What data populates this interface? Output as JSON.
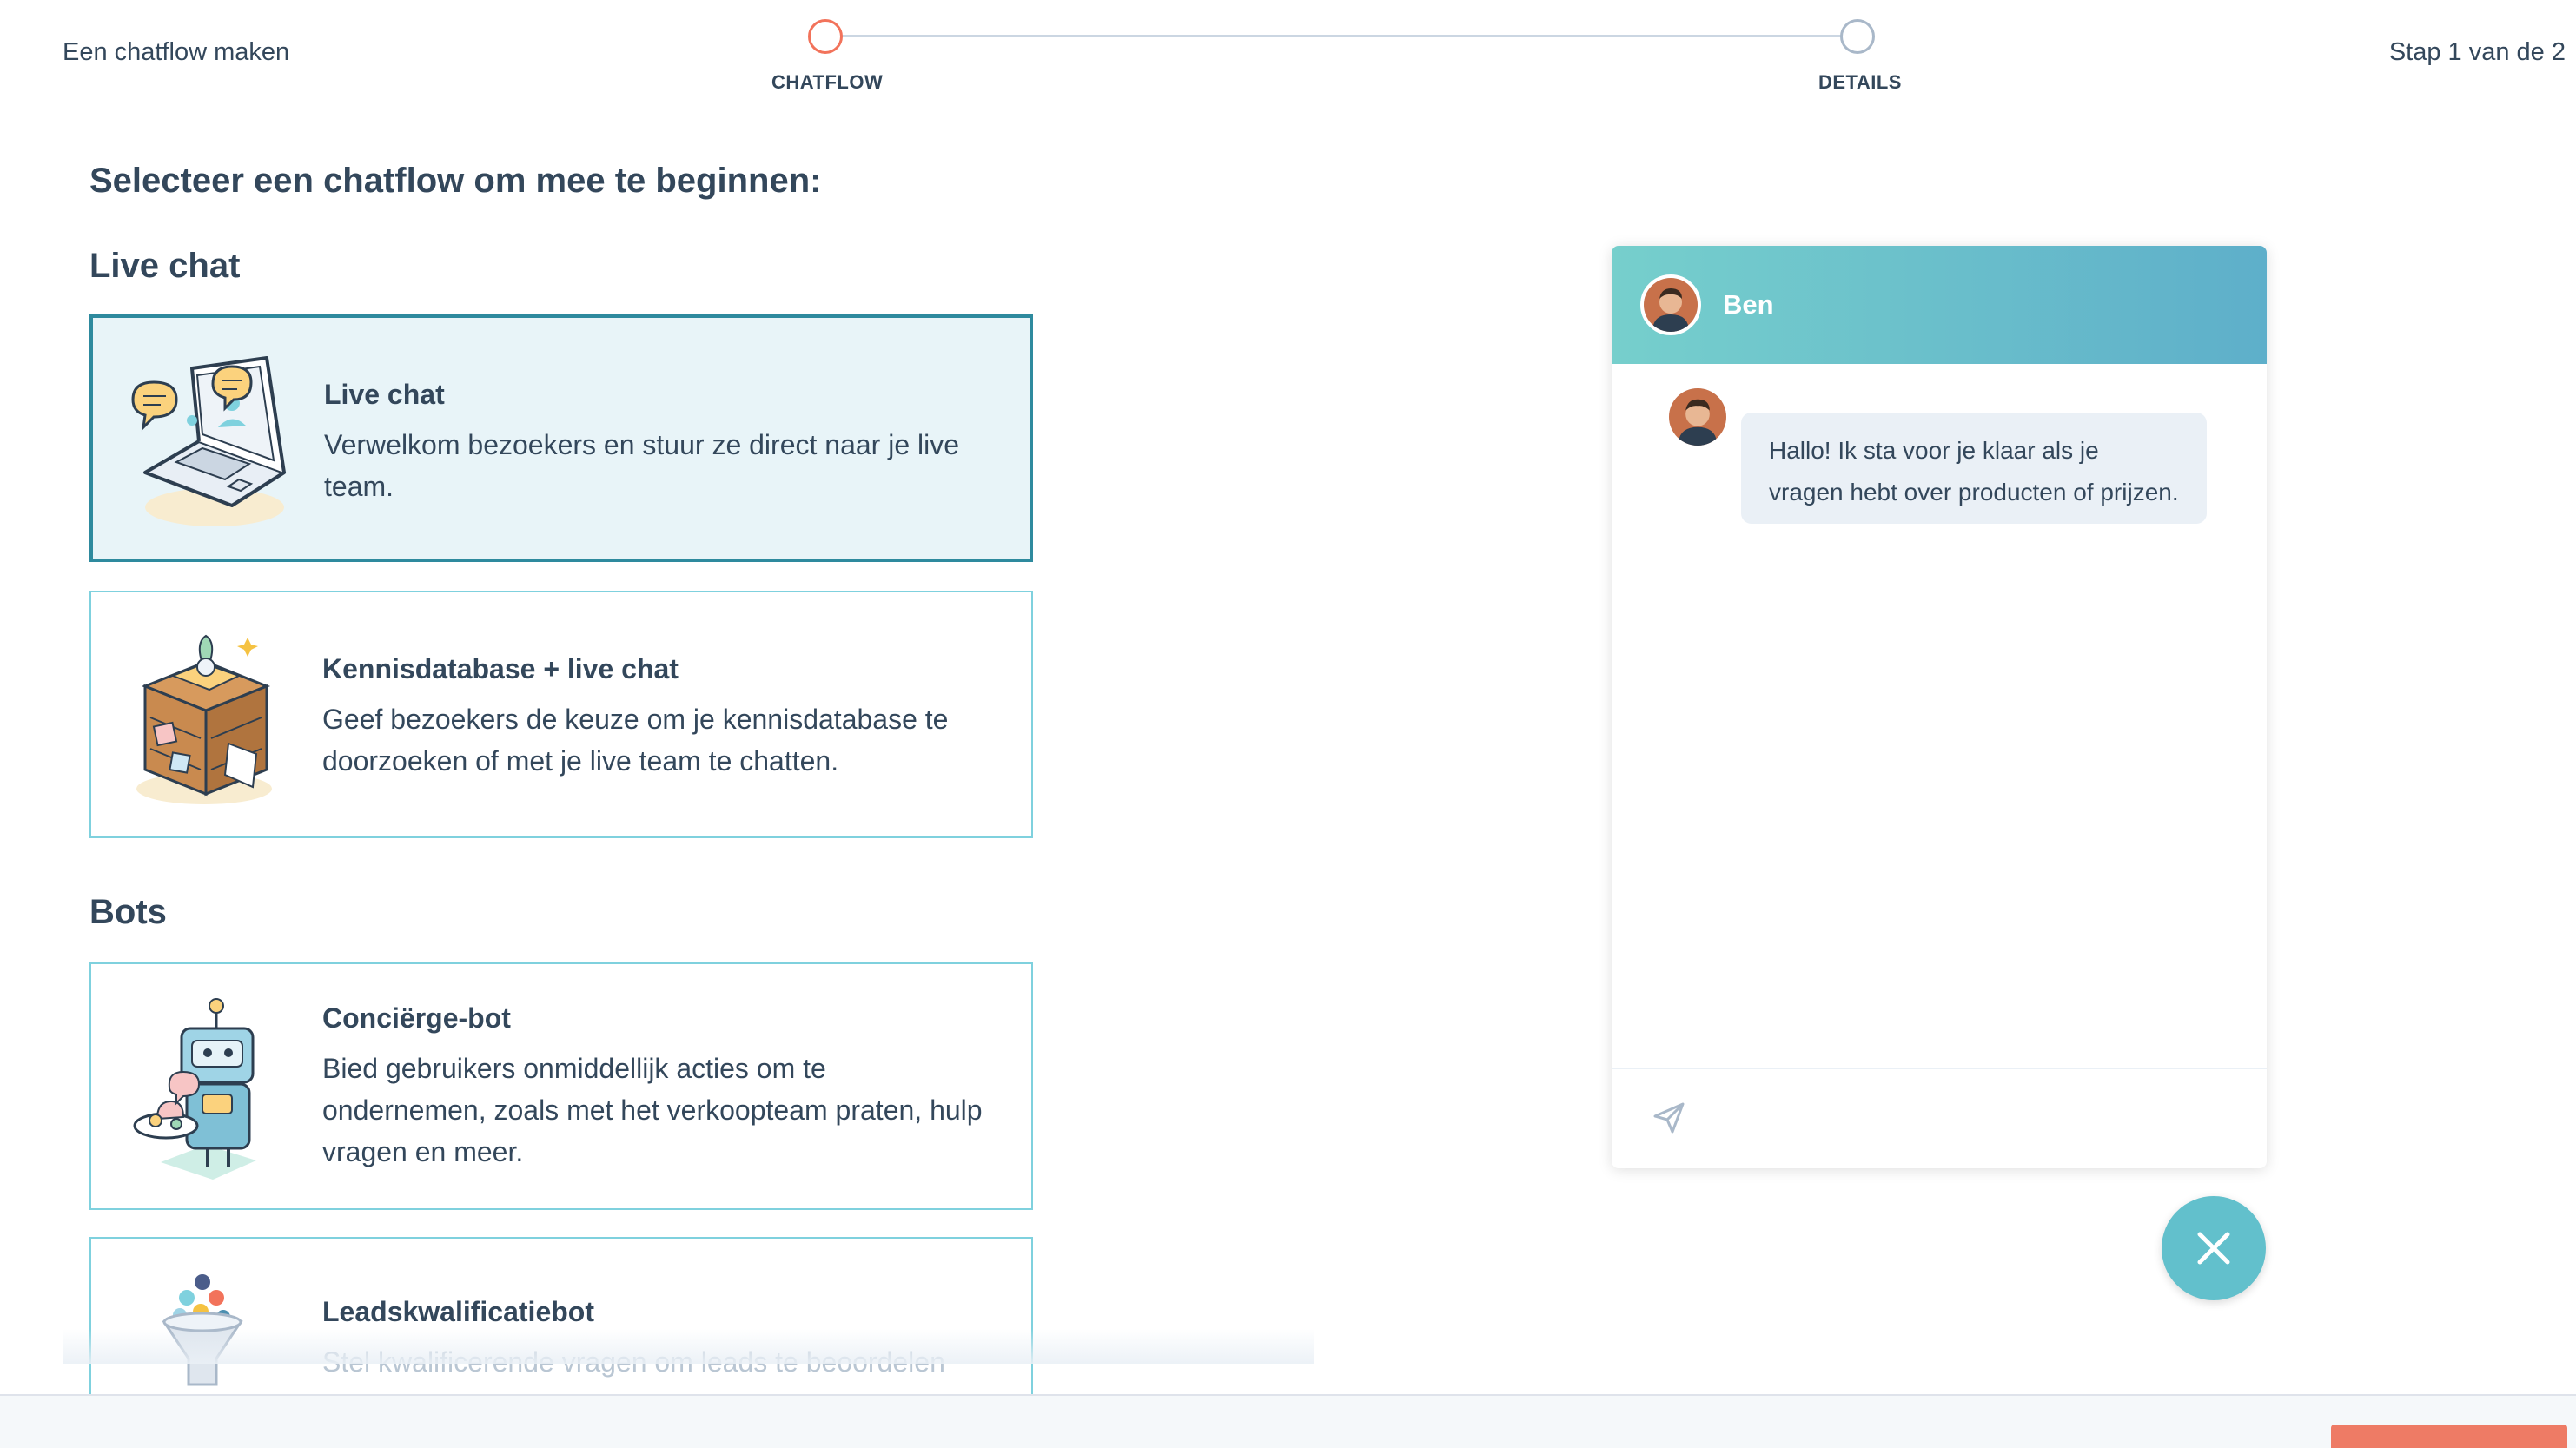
{
  "header": {
    "app_title": "Een chatflow maken",
    "step_count": "Stap 1 van de 2",
    "steps": [
      {
        "label": "CHATFLOW",
        "state": "active"
      },
      {
        "label": "DETAILS",
        "state": "upcoming"
      }
    ]
  },
  "main": {
    "heading": "Selecteer een chatflow om mee te beginnen:",
    "sections": [
      {
        "title": "Live chat",
        "cards": [
          {
            "title": "Live chat",
            "description": "Verwelkom bezoekers en stuur ze direct naar je live team.",
            "icon": "laptop-chat-illustration",
            "selected": true
          },
          {
            "title": "Kennisdatabase + live chat",
            "description": "Geef bezoekers de keuze om je kennisdatabase te doorzoeken of met je live team te chatten.",
            "icon": "knowledge-cabinet-illustration",
            "selected": false
          }
        ]
      },
      {
        "title": "Bots",
        "cards": [
          {
            "title": "Conciërge-bot",
            "description": "Bied gebruikers onmiddellijk acties om te ondernemen, zoals met het verkoopteam praten, hulp vragen en meer.",
            "icon": "concierge-robot-illustration",
            "selected": false
          },
          {
            "title": "Leadskwalificatiebot",
            "description": "Stel kwalificerende vragen om leads te beoordelen",
            "icon": "funnel-illustration",
            "selected": false
          }
        ]
      }
    ]
  },
  "preview": {
    "agent_name": "Ben",
    "message": "Hallo! Ik sta voor je klaar als je vragen hebt over producten of prijzen.",
    "send_icon": "paper-plane-icon",
    "close_icon": "close-icon"
  },
  "colors": {
    "accent_orange": "#f2735b",
    "selected_border": "#2e8a9e",
    "selected_bg": "#e8f4f8",
    "card_border": "#7fd1de",
    "header_gradient_start": "#76cfcc",
    "header_gradient_end": "#5eafca",
    "fab": "#62c0cc",
    "text": "#33475b"
  }
}
